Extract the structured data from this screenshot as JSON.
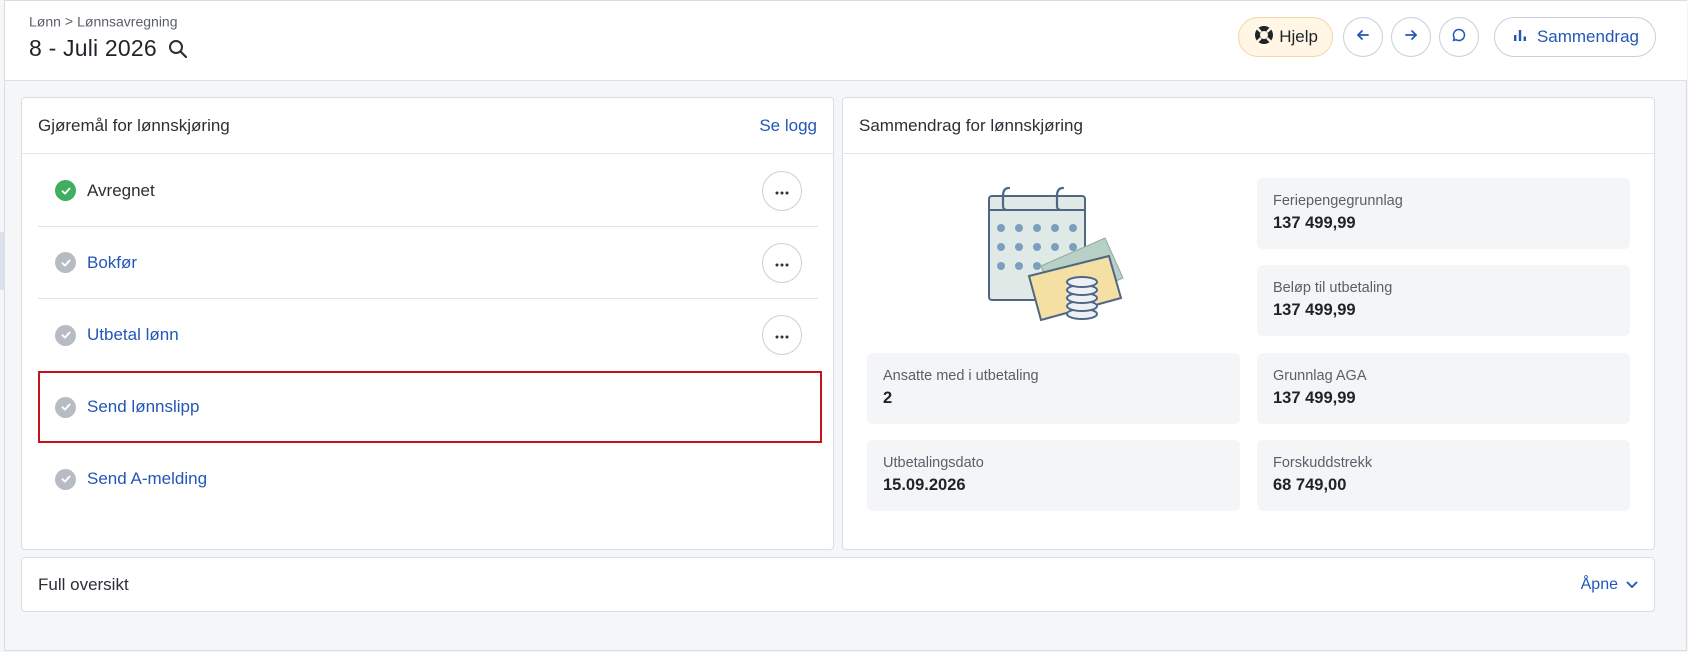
{
  "breadcrumb": {
    "parent": "Lønn",
    "separator": ">",
    "current": "Lønnsavregning"
  },
  "page_title": "8 - Juli 2026",
  "header_actions": {
    "help_label": "Hjelp",
    "summary_label": "Sammendrag"
  },
  "todo": {
    "title": "Gjøremål for lønnskjøring",
    "log_link": "Se logg",
    "items": [
      {
        "label": "Avregnet",
        "status": "done"
      },
      {
        "label": "Bokfør",
        "status": "pending"
      },
      {
        "label": "Utbetal lønn",
        "status": "pending"
      },
      {
        "label": "Send lønnslipp",
        "status": "pending"
      },
      {
        "label": "Send A-melding",
        "status": "pending"
      }
    ]
  },
  "summary": {
    "title": "Sammendrag for lønnskjøring",
    "stats": [
      {
        "label": "Feriepengegrunnlag",
        "value": "137 499,99"
      },
      {
        "label": "Beløp til utbetaling",
        "value": "137 499,99"
      },
      {
        "label": "Ansatte med i utbetaling",
        "value": "2"
      },
      {
        "label": "Grunnlag AGA",
        "value": "137 499,99"
      },
      {
        "label": "Utbetalingsdato",
        "value": "15.09.2026"
      },
      {
        "label": "Forskuddstrekk",
        "value": "68 749,00"
      }
    ]
  },
  "full_overview": {
    "title": "Full oversikt",
    "open_label": "Åpne"
  },
  "colors": {
    "accent": "#2356b8",
    "success": "#3fae5f",
    "pending": "#b7bcc3",
    "highlight_border": "#c4141b",
    "help_bg": "#fff6e5"
  },
  "icons": [
    "search-icon",
    "lifebuoy-icon",
    "arrow-left-icon",
    "arrow-right-icon",
    "chat-bubble-icon",
    "bar-chart-icon",
    "check-icon",
    "more-horizontal-icon",
    "chevron-down-icon",
    "calendar-money-illustration"
  ]
}
